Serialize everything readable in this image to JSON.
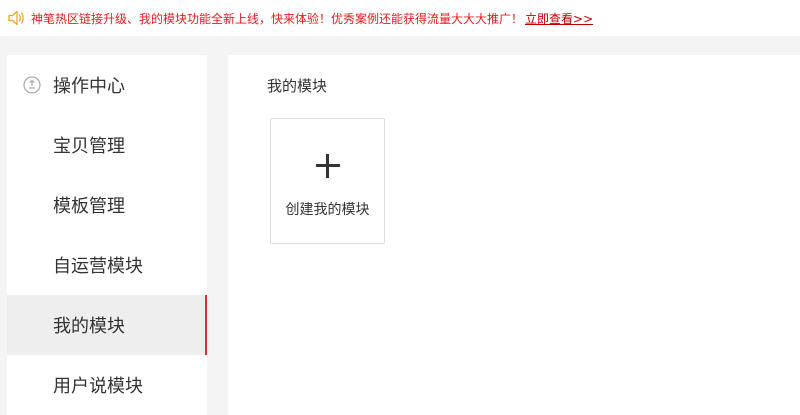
{
  "notice": {
    "icon": "speaker-icon",
    "text": "神笔热区链接升级、我的模块功能全新上线，快来体验！优秀案例还能获得流量大大大推广！",
    "link": "立即查看>>"
  },
  "sidebar": {
    "items": [
      {
        "label": "操作中心",
        "icon": "operation-center-icon"
      },
      {
        "label": "宝贝管理"
      },
      {
        "label": "模板管理"
      },
      {
        "label": "自运营模块"
      },
      {
        "label": "我的模块",
        "active": true
      },
      {
        "label": "用户说模块"
      }
    ]
  },
  "main": {
    "title": "我的模块",
    "create_card": {
      "label": "创建我的模块",
      "icon": "plus-icon"
    }
  },
  "colors": {
    "accent": "#d9302f",
    "notice_text": "#e02020",
    "active_bg": "#eeeeee"
  }
}
